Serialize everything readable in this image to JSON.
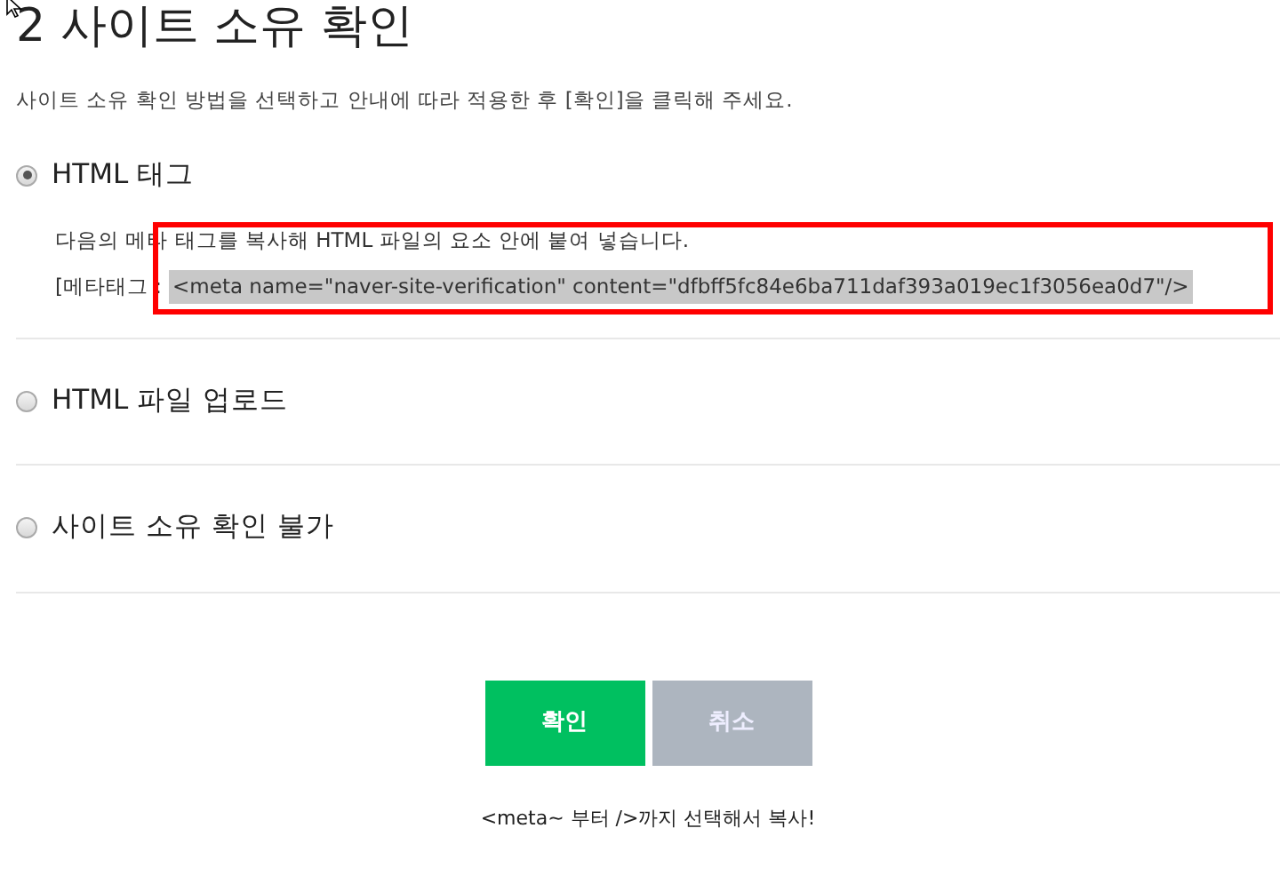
{
  "title": "2 사이트 소유 확인",
  "description": "사이트 소유 확인 방법을 선택하고 안내에 따라 적용한 후 [확인]을 클릭해 주세요.",
  "options": [
    {
      "label": "HTML 태그",
      "selected": true,
      "instruction": "다음의 메타 태그를 복사해 HTML 파일의 요소 안에 붙여 넣습니다.",
      "field_label": "[메타태그 :",
      "code": "<meta name=\"naver-site-verification\" content=\"dfbff5fc84e6ba711daf393a019ec1f3056ea0d7\"/>",
      "code_highlighted": true
    },
    {
      "label": "HTML 파일 업로드",
      "selected": false
    },
    {
      "label": "사이트 소유 확인 불가",
      "selected": false
    }
  ],
  "buttons": [
    {
      "label": "확인",
      "kind": "primary"
    },
    {
      "label": "취소",
      "kind": "secondary"
    }
  ],
  "note": "<meta~ 부터 />까지 선택해서 복사!"
}
